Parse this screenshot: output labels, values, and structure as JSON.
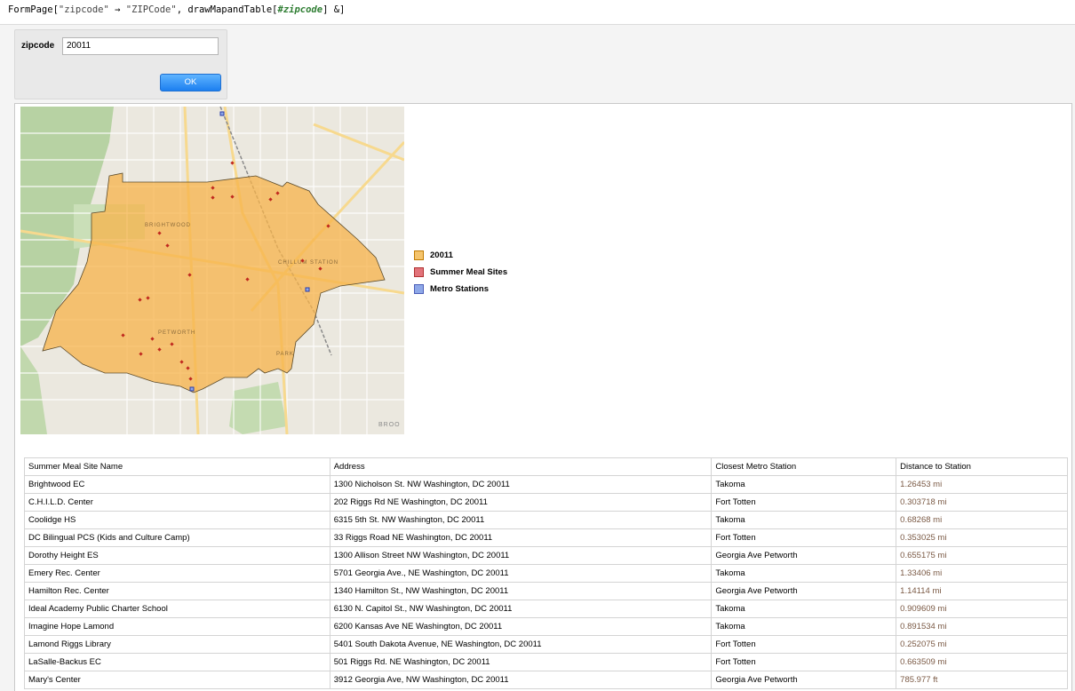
{
  "code": {
    "fn": "FormPage",
    "arg1": "\"zipcode\"",
    "arrow": "→",
    "arg2": "\"ZIPCode\"",
    "fn2": ", drawMapandTable[",
    "slot": "#zipcode",
    "tail": "] &]"
  },
  "form": {
    "label": "zipcode",
    "value": "20011",
    "ok_label": "OK"
  },
  "legend": [
    {
      "label": "20011",
      "color": "#f5c46c",
      "border": "#c07a00"
    },
    {
      "label": "Summer Meal Sites",
      "color": "#e2737a",
      "border": "#b03030"
    },
    {
      "label": "Metro Stations",
      "color": "#8ea8e8",
      "border": "#4a5db8"
    }
  ],
  "map_text": {
    "brightwood": "BRIGHTWOOD",
    "petworth": "PETWORTH",
    "chillum": "CHILLUM STATION",
    "park": "PARK",
    "brook": "BROO"
  },
  "table": {
    "headers": [
      "Summer Meal Site Name",
      "Address",
      "Closest Metro Station",
      "Distance to Station"
    ],
    "rows": [
      [
        "Brightwood EC",
        "1300 Nicholson St. NW Washington, DC 20011",
        "Takoma",
        "1.26453 mi"
      ],
      [
        "C.H.I.L.D. Center",
        "202 Riggs Rd NE Washington, DC 20011",
        "Fort Totten",
        "0.303718 mi"
      ],
      [
        "Coolidge HS",
        "6315 5th St. NW Washington, DC 20011",
        "Takoma",
        "0.68268 mi"
      ],
      [
        "DC Bilingual PCS (Kids and Culture Camp)",
        "33 Riggs Road NE Washington, DC 20011",
        "Fort Totten",
        "0.353025 mi"
      ],
      [
        "Dorothy Height ES",
        "1300 Allison Street NW Washington, DC 20011",
        "Georgia Ave Petworth",
        "0.655175 mi"
      ],
      [
        "Emery Rec. Center",
        "5701 Georgia Ave., NE Washington, DC 20011",
        "Takoma",
        "1.33406 mi"
      ],
      [
        "Hamilton Rec. Center",
        "1340 Hamilton St., NW Washington, DC 20011",
        "Georgia Ave Petworth",
        "1.14114 mi"
      ],
      [
        "Ideal Academy Public Charter School",
        "6130 N. Capitol St., NW Washington, DC 20011",
        "Takoma",
        "0.909609 mi"
      ],
      [
        "Imagine Hope Lamond",
        "6200 Kansas Ave NE Washington, DC 20011",
        "Takoma",
        "0.891534 mi"
      ],
      [
        "Lamond Riggs Library",
        "5401 South Dakota Avenue, NE Washington, DC 20011",
        "Fort Totten",
        "0.252075 mi"
      ],
      [
        "LaSalle-Backus EC",
        "501 Riggs Rd. NE Washington, DC 20011",
        "Fort Totten",
        "0.663509 mi"
      ],
      [
        "Mary's Center",
        "3912 Georgia Ave, NW Washington, DC 20011",
        "Georgia Ave Petworth",
        "785.977 ft"
      ]
    ]
  }
}
